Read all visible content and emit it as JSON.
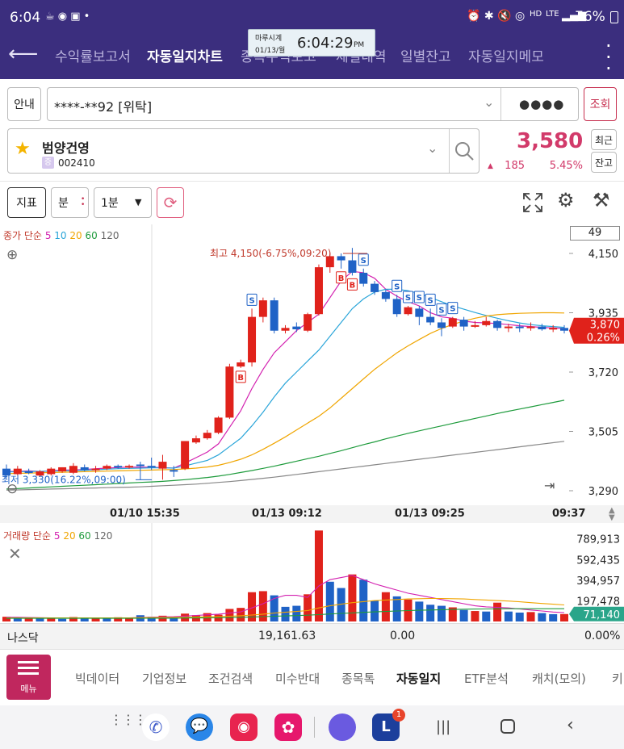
{
  "status": {
    "time": "6:04",
    "battery": "76%",
    "lte": "LTE",
    "hd": "HD"
  },
  "nav": {
    "tabs": [
      "수익률보고서",
      "자동일지차트",
      "종목수익보고",
      "체결내역",
      "일별잔고",
      "자동일지메모"
    ],
    "active_index": 1
  },
  "clock": {
    "label": "마루시계",
    "date": "01/13/월",
    "time": "6:04:29",
    "ampm": "PM"
  },
  "account": {
    "guide_label": "안내",
    "number": "****-**92 [위탁]",
    "password": "●●●●",
    "query_label": "조회"
  },
  "stock": {
    "name": "범양건영",
    "market_badge": "증",
    "code": "002410",
    "price": "3,580",
    "change": "185",
    "change_pct": "5.45%",
    "recent_label": "최근",
    "balance_label": "잔고"
  },
  "toolbar": {
    "indicator_label": "지표",
    "unit_label": "분",
    "interval": "1분"
  },
  "price_chart": {
    "legend_prefix": "종가 단순",
    "legend_periods": [
      "5",
      "10",
      "20",
      "60",
      "120"
    ],
    "period_box": "49",
    "high_label": "최고 4,150(-6.75%,09:20)",
    "low_label": "최저 3,330(16.22%,09:00)",
    "current_price": "3,870",
    "current_pct": "0.26%",
    "time_labels": [
      "01/10 15:35",
      "01/13 09:12",
      "01/13 09:25",
      "09:37"
    ]
  },
  "volume_chart": {
    "legend_prefix": "거래량 단순",
    "legend_periods": [
      "5",
      "20",
      "60",
      "120"
    ],
    "current_volume": "71,140"
  },
  "index_bar": {
    "name": "나스닥",
    "value": "19,161.63",
    "change": "0.00",
    "change_pct": "0.00%"
  },
  "bottom_menu": {
    "menu_label": "메뉴",
    "tabs": [
      "빅데이터",
      "기업정보",
      "조건검색",
      "미수반대",
      "종목톡",
      "자동일지",
      "ETF분석",
      "캐치(모의)",
      "키"
    ],
    "active_index": 5
  },
  "dock": {
    "badge": "1"
  },
  "colors": {
    "up": "#e0221b",
    "down": "#1f62c6",
    "brand": "#3b2e7e",
    "ma5": "#d321b0",
    "ma10": "#2aa5d9",
    "ma20": "#f0a500",
    "ma60": "#1e9b3c",
    "ma120": "#888888"
  },
  "chart_data": [
    {
      "type": "candlestick",
      "title": "",
      "y_ticks": [
        4150,
        3935,
        3720,
        3505,
        3290
      ],
      "ylim": [
        3290,
        4150
      ],
      "x_tick_labels": [
        "01/10 15:35",
        "01/13 09:12",
        "01/13 09:25",
        "09:37"
      ],
      "candles": [
        {
          "o": 3370,
          "h": 3385,
          "c": 3345,
          "l": 3335
        },
        {
          "o": 3350,
          "h": 3380,
          "c": 3370,
          "l": 3345
        },
        {
          "o": 3360,
          "h": 3370,
          "c": 3355,
          "l": 3350
        },
        {
          "o": 3345,
          "h": 3365,
          "c": 3360,
          "l": 3340
        },
        {
          "o": 3350,
          "h": 3375,
          "c": 3370,
          "l": 3345
        },
        {
          "o": 3360,
          "h": 3375,
          "c": 3375,
          "l": 3355
        },
        {
          "o": 3355,
          "h": 3390,
          "c": 3380,
          "l": 3350
        },
        {
          "o": 3375,
          "h": 3385,
          "c": 3365,
          "l": 3360
        },
        {
          "o": 3365,
          "h": 3380,
          "c": 3370,
          "l": 3355
        },
        {
          "o": 3370,
          "h": 3385,
          "c": 3380,
          "l": 3365
        },
        {
          "o": 3380,
          "h": 3385,
          "c": 3375,
          "l": 3370
        },
        {
          "o": 3375,
          "h": 3385,
          "c": 3380,
          "l": 3370
        },
        {
          "o": 3385,
          "h": 3395,
          "c": 3380,
          "l": 3330
        },
        {
          "o": 3380,
          "h": 3410,
          "c": 3375,
          "l": 3365
        },
        {
          "o": 3370,
          "h": 3420,
          "c": 3395,
          "l": 3330
        },
        {
          "o": 3365,
          "h": 3380,
          "c": 3360,
          "l": 3340
        },
        {
          "o": 3370,
          "h": 3470,
          "c": 3470,
          "l": 3365
        },
        {
          "o": 3465,
          "h": 3490,
          "c": 3480,
          "l": 3460
        },
        {
          "o": 3480,
          "h": 3510,
          "c": 3500,
          "l": 3475
        },
        {
          "o": 3500,
          "h": 3560,
          "c": 3555,
          "l": 3495
        },
        {
          "o": 3555,
          "h": 3750,
          "c": 3740,
          "l": 3550
        },
        {
          "o": 3740,
          "h": 3765,
          "c": 3755,
          "l": 3735
        },
        {
          "o": 3755,
          "h": 3950,
          "c": 3920,
          "l": 3740
        },
        {
          "o": 3920,
          "h": 3990,
          "c": 3980,
          "l": 3900
        },
        {
          "o": 3980,
          "h": 3990,
          "c": 3870,
          "l": 3860
        },
        {
          "o": 3870,
          "h": 3890,
          "c": 3880,
          "l": 3860
        },
        {
          "o": 3885,
          "h": 3900,
          "c": 3875,
          "l": 3865
        },
        {
          "o": 3870,
          "h": 3935,
          "c": 3930,
          "l": 3865
        },
        {
          "o": 3930,
          "h": 4110,
          "c": 4100,
          "l": 3925
        },
        {
          "o": 4100,
          "h": 4150,
          "c": 4140,
          "l": 4080
        },
        {
          "o": 4140,
          "h": 4150,
          "c": 4125,
          "l": 4095
        },
        {
          "o": 4125,
          "h": 4170,
          "c": 4080,
          "l": 4070
        },
        {
          "o": 4080,
          "h": 4095,
          "c": 4040,
          "l": 4030
        },
        {
          "o": 4040,
          "h": 4050,
          "c": 4010,
          "l": 4000
        },
        {
          "o": 4010,
          "h": 4020,
          "c": 3985,
          "l": 3975
        },
        {
          "o": 3985,
          "h": 4000,
          "c": 3930,
          "l": 3920
        },
        {
          "o": 3930,
          "h": 3960,
          "c": 3955,
          "l": 3925
        },
        {
          "o": 3950,
          "h": 3960,
          "c": 3920,
          "l": 3890
        },
        {
          "o": 3920,
          "h": 3950,
          "c": 3900,
          "l": 3890
        },
        {
          "o": 3900,
          "h": 3915,
          "c": 3880,
          "l": 3850
        },
        {
          "o": 3885,
          "h": 3920,
          "c": 3915,
          "l": 3880
        },
        {
          "o": 3910,
          "h": 3920,
          "c": 3885,
          "l": 3870
        },
        {
          "o": 3885,
          "h": 3905,
          "c": 3890,
          "l": 3880
        },
        {
          "o": 3890,
          "h": 3920,
          "c": 3905,
          "l": 3885
        },
        {
          "o": 3905,
          "h": 3910,
          "c": 3880,
          "l": 3870
        },
        {
          "o": 3880,
          "h": 3895,
          "c": 3885,
          "l": 3865
        },
        {
          "o": 3885,
          "h": 3895,
          "c": 3880,
          "l": 3865
        },
        {
          "o": 3880,
          "h": 3900,
          "c": 3885,
          "l": 3870
        },
        {
          "o": 3885,
          "h": 3895,
          "c": 3875,
          "l": 3870
        },
        {
          "o": 3875,
          "h": 3890,
          "c": 3880,
          "l": 3865
        },
        {
          "o": 3880,
          "h": 3890,
          "c": 3870,
          "l": 3860
        }
      ],
      "moving_averages": [
        {
          "period": "5",
          "color": "#d321b0",
          "points": [
            3360,
            3360,
            3362,
            3360,
            3362,
            3365,
            3365,
            3367,
            3370,
            3372,
            3374,
            3376,
            3375,
            3375,
            3374,
            3372,
            3390,
            3410,
            3430,
            3460,
            3520,
            3580,
            3660,
            3730,
            3790,
            3830,
            3870,
            3900,
            3930,
            3990,
            4050,
            4085,
            4080,
            4060,
            4020,
            3995,
            3975,
            3960,
            3935,
            3920,
            3915,
            3905,
            3900,
            3898,
            3896,
            3892,
            3888,
            3885,
            3882,
            3880,
            3878
          ]
        },
        {
          "period": "10",
          "color": "#2aa5d9",
          "points": [
            3358,
            3359,
            3360,
            3360,
            3361,
            3362,
            3363,
            3364,
            3366,
            3368,
            3370,
            3371,
            3372,
            3373,
            3373,
            3372,
            3380,
            3390,
            3400,
            3420,
            3450,
            3480,
            3525,
            3575,
            3630,
            3680,
            3720,
            3760,
            3800,
            3850,
            3900,
            3950,
            3985,
            4010,
            4020,
            4020,
            4015,
            4005,
            3990,
            3975,
            3960,
            3948,
            3936,
            3925,
            3915,
            3906,
            3898,
            3892,
            3888,
            3885,
            3882
          ]
        },
        {
          "period": "20",
          "color": "#f0a500",
          "points": [
            3352,
            3353,
            3354,
            3355,
            3356,
            3357,
            3358,
            3359,
            3360,
            3361,
            3362,
            3363,
            3364,
            3365,
            3366,
            3367,
            3369,
            3372,
            3376,
            3382,
            3392,
            3404,
            3420,
            3440,
            3462,
            3485,
            3510,
            3535,
            3560,
            3590,
            3625,
            3660,
            3695,
            3730,
            3760,
            3790,
            3815,
            3838,
            3860,
            3878,
            3893,
            3905,
            3915,
            3923,
            3928,
            3931,
            3933,
            3934,
            3935,
            3935,
            3934
          ]
        },
        {
          "period": "60",
          "color": "#1e9b3c",
          "points": [
            3296,
            3298,
            3300,
            3302,
            3304,
            3306,
            3308,
            3310,
            3312,
            3314,
            3316,
            3318,
            3320,
            3322,
            3324,
            3327,
            3330,
            3334,
            3338,
            3343,
            3349,
            3356,
            3363,
            3371,
            3379,
            3388,
            3397,
            3406,
            3415,
            3425,
            3435,
            3446,
            3457,
            3467,
            3478,
            3488,
            3498,
            3507,
            3516,
            3525,
            3534,
            3543,
            3552,
            3561,
            3570,
            3578,
            3586,
            3594,
            3602,
            3610,
            3618
          ]
        },
        {
          "period": "120",
          "color": "#888888",
          "points": [
            3292,
            3293,
            3294,
            3295,
            3296,
            3297,
            3298,
            3299,
            3300,
            3301,
            3302,
            3303,
            3304,
            3306,
            3308,
            3310,
            3312,
            3314,
            3317,
            3320,
            3323,
            3327,
            3331,
            3335,
            3339,
            3344,
            3349,
            3354,
            3359,
            3364,
            3369,
            3374,
            3379,
            3384,
            3389,
            3394,
            3399,
            3404,
            3409,
            3414,
            3419,
            3424,
            3429,
            3434,
            3439,
            3444,
            3449,
            3454,
            3459,
            3464,
            3469
          ]
        }
      ],
      "markers": [
        {
          "index": 21,
          "label": "B",
          "type": "buy"
        },
        {
          "index": 22,
          "label": "S",
          "type": "sell"
        },
        {
          "index": 30,
          "label": "B",
          "type": "buy"
        },
        {
          "index": 31,
          "label": "B",
          "type": "buy"
        },
        {
          "index": 32,
          "label": "S",
          "type": "sell"
        },
        {
          "index": 35,
          "label": "S",
          "type": "sell"
        },
        {
          "index": 36,
          "label": "S",
          "type": "sell"
        },
        {
          "index": 37,
          "label": "S",
          "type": "sell"
        },
        {
          "index": 38,
          "label": "S",
          "type": "sell"
        },
        {
          "index": 39,
          "label": "S",
          "type": "sell"
        },
        {
          "index": 40,
          "label": "S",
          "type": "sell"
        }
      ]
    },
    {
      "type": "bar",
      "title": "",
      "y_ticks": [
        789913,
        592435,
        394957,
        197478
      ],
      "ylim": [
        0,
        880000
      ],
      "values": [
        45000,
        38000,
        30000,
        28000,
        32000,
        25000,
        42000,
        30000,
        35000,
        28000,
        40000,
        32000,
        60000,
        45000,
        55000,
        38000,
        75000,
        60000,
        80000,
        65000,
        120000,
        130000,
        280000,
        290000,
        250000,
        140000,
        150000,
        260000,
        870000,
        380000,
        320000,
        450000,
        400000,
        200000,
        280000,
        240000,
        210000,
        190000,
        160000,
        150000,
        135000,
        110000,
        100000,
        95000,
        180000,
        95000,
        85000,
        90000,
        80000,
        70000,
        71140
      ],
      "directions": [
        "up",
        "down",
        "up",
        "down",
        "up",
        "down",
        "up",
        "down",
        "up",
        "down",
        "up",
        "up",
        "down",
        "down",
        "up",
        "down",
        "up",
        "up",
        "up",
        "up",
        "up",
        "up",
        "up",
        "up",
        "down",
        "down",
        "down",
        "up",
        "up",
        "down",
        "down",
        "up",
        "down",
        "down",
        "up",
        "down",
        "up",
        "down",
        "down",
        "down",
        "up",
        "down",
        "up",
        "down",
        "up",
        "down",
        "down",
        "up",
        "down",
        "down",
        "up"
      ],
      "moving_averages": [
        {
          "period": "5",
          "color": "#d321b0",
          "points": [
            40000,
            40000,
            38000,
            36000,
            34000,
            32000,
            33000,
            34000,
            35000,
            34000,
            34000,
            34000,
            38000,
            40000,
            44000,
            46000,
            52000,
            58000,
            64000,
            70000,
            80000,
            92000,
            130000,
            170000,
            220000,
            250000,
            250000,
            230000,
            340000,
            400000,
            420000,
            440000,
            400000,
            360000,
            330000,
            300000,
            270000,
            250000,
            230000,
            210000,
            190000,
            170000,
            150000,
            140000,
            135000,
            130000,
            120000,
            110000,
            100000,
            90000,
            85000
          ]
        },
        {
          "period": "20",
          "color": "#f0a500",
          "points": [
            35000,
            35000,
            35000,
            35000,
            35000,
            35000,
            35000,
            35000,
            35000,
            35000,
            35000,
            35000,
            36000,
            37000,
            38000,
            39000,
            40000,
            42000,
            44000,
            47000,
            50000,
            55000,
            62000,
            70000,
            80000,
            88000,
            96000,
            104000,
            130000,
            150000,
            165000,
            180000,
            190000,
            200000,
            205000,
            210000,
            215000,
            218000,
            220000,
            220000,
            218000,
            215000,
            210000,
            205000,
            200000,
            195000,
            188000,
            180000,
            172000,
            165000,
            158000
          ]
        },
        {
          "period": "60",
          "color": "#1e9b3c",
          "points": [
            30000,
            30000,
            30000,
            30000,
            30000,
            30000,
            30000,
            30000,
            30000,
            30000,
            30000,
            30000,
            31000,
            31000,
            32000,
            32000,
            33000,
            34000,
            35000,
            36000,
            38000,
            40000,
            43000,
            46000,
            50000,
            53000,
            56000,
            60000,
            66000,
            72000,
            77000,
            82000,
            87000,
            92000,
            96000,
            100000,
            104000,
            107000,
            110000,
            113000,
            115000,
            117000,
            119000,
            120000,
            121000,
            122000,
            122000,
            122000,
            122000,
            122000,
            122000
          ]
        }
      ]
    }
  ]
}
